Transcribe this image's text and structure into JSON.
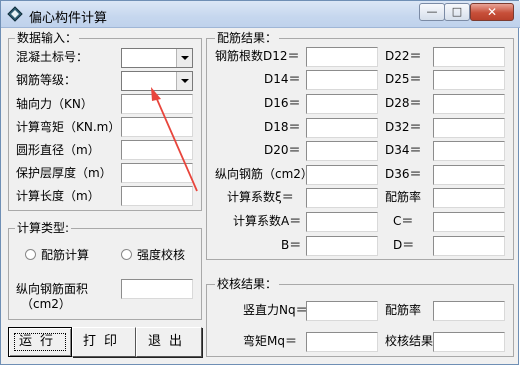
{
  "window": {
    "title": "偏心构件计算",
    "min_glyph": "—",
    "max_glyph": "□",
    "close_glyph": "✕"
  },
  "input_group": {
    "title": "数据输入：",
    "concrete_label": "混凝土标号：",
    "rebar_label": "钢筋等级：",
    "axial_label": "轴向力（KN）",
    "moment_label": "计算弯矩（KN.m）",
    "diameter_label": "圆形直径（m）",
    "cover_label": "保护层厚度（m）",
    "length_label": "计算长度（m）"
  },
  "calc_type_group": {
    "title": "计算类型:",
    "option_rebar": "配筋计算",
    "option_strength": "强度校核",
    "area_label_line1": "纵向钢筋面积",
    "area_label_line2": "（cm2）"
  },
  "rebar_result_group": {
    "title": "配筋结果：",
    "d12": "钢筋根数D12＝",
    "d14": "D14＝",
    "d16": "D16＝",
    "d18": "D18＝",
    "d20": "D20＝",
    "d22": "D22＝",
    "d25": "D25＝",
    "d28": "D28＝",
    "d32": "D32＝",
    "d34": "D34＝",
    "d36": "D36＝",
    "long_rebar": "纵向钢筋（cm2）",
    "coef_xi": "计算系数ξ＝",
    "ratio": "配筋率",
    "coef_a": "计算系数A＝",
    "c": "C＝",
    "b": "B＝",
    "d": "D＝"
  },
  "check_group": {
    "title": "校核结果：",
    "nq": "竖直力Nq＝",
    "ratio": "配筋率",
    "mq": "弯矩Mq＝",
    "result": "校核结果"
  },
  "buttons": {
    "run": "运行",
    "print": "打印",
    "exit": "退出"
  },
  "colors": {
    "annotation_arrow": "#e8453c"
  }
}
